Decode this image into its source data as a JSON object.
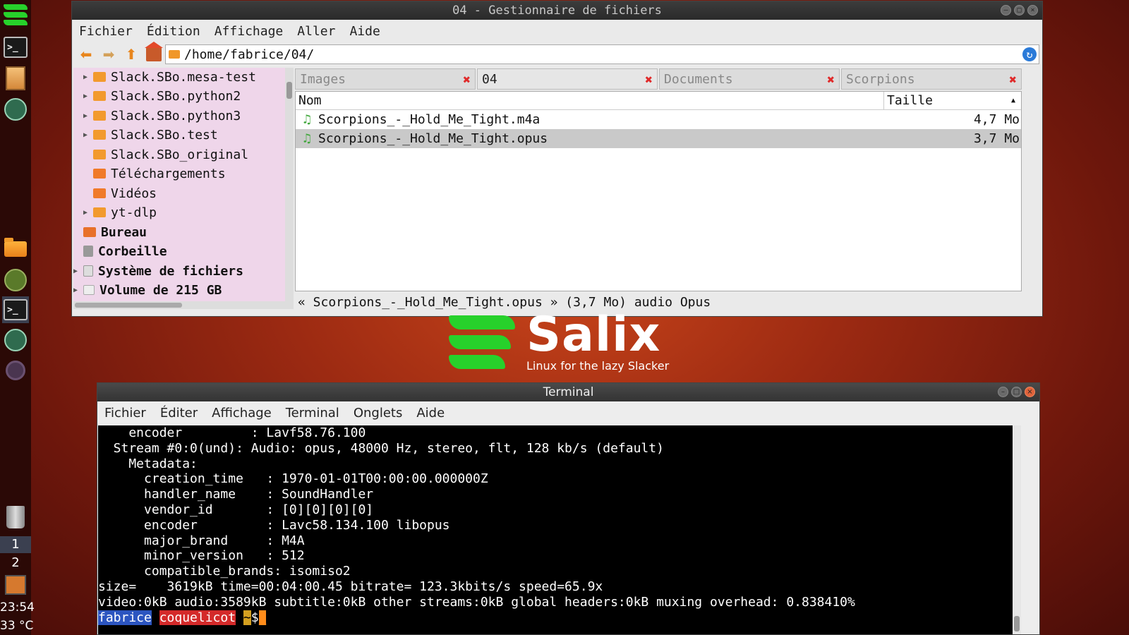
{
  "dock": {
    "workspaces": [
      "1",
      "2"
    ],
    "clock": "23:54",
    "temperature": "33 °C"
  },
  "file_manager": {
    "title": "04 - Gestionnaire de fichiers",
    "menu": [
      "Fichier",
      "Édition",
      "Affichage",
      "Aller",
      "Aide"
    ],
    "path": "/home/fabrice/04/",
    "tree": [
      {
        "label": "Slack.SBo.mesa-test",
        "expandable": true
      },
      {
        "label": "Slack.SBo.python2",
        "expandable": true
      },
      {
        "label": "Slack.SBo.python3",
        "expandable": true
      },
      {
        "label": "Slack.SBo.test",
        "expandable": true
      },
      {
        "label": "Slack.SBo_original",
        "expandable": false
      },
      {
        "label": "Téléchargements",
        "expandable": false
      },
      {
        "label": "Vidéos",
        "expandable": false
      },
      {
        "label": "yt-dlp",
        "expandable": true
      }
    ],
    "places": [
      {
        "label": "Bureau",
        "expandable": false
      },
      {
        "label": "Corbeille",
        "expandable": false
      },
      {
        "label": "Système de fichiers",
        "expandable": true
      },
      {
        "label": "Volume de 215 GB",
        "expandable": true
      }
    ],
    "tabs": [
      "Images",
      "04",
      "Documents",
      "Scorpions"
    ],
    "active_tab": "04",
    "columns": {
      "name": "Nom",
      "size": "Taille"
    },
    "files": [
      {
        "name": "Scorpions_-_Hold_Me_Tight.m4a",
        "size": "4,7 Mo",
        "selected": false
      },
      {
        "name": "Scorpions_-_Hold_Me_Tight.opus",
        "size": "3,7 Mo",
        "selected": true
      }
    ],
    "status": "« Scorpions_-_Hold_Me_Tight.opus » (3,7 Mo) audio Opus"
  },
  "logo": {
    "name": "Salix",
    "tagline": "Linux for the lazy Slacker"
  },
  "terminal": {
    "title": "Terminal",
    "menu": [
      "Fichier",
      "Éditer",
      "Affichage",
      "Terminal",
      "Onglets",
      "Aide"
    ],
    "lines": [
      "    encoder         : Lavf58.76.100",
      "  Stream #0:0(und): Audio: opus, 48000 Hz, stereo, flt, 128 kb/s (default)",
      "    Metadata:",
      "      creation_time   : 1970-01-01T00:00:00.000000Z",
      "      handler_name    : SoundHandler",
      "      vendor_id       : [0][0][0][0]",
      "      encoder         : Lavc58.134.100 libopus",
      "      major_brand     : M4A",
      "      minor_version   : 512",
      "      compatible_brands: isomiso2",
      "size=    3619kB time=00:04:00.45 bitrate= 123.3kbits/s speed=65.9x",
      "video:0kB audio:3589kB subtitle:0kB other streams:0kB global headers:0kB muxing overhead: 0.838410%"
    ],
    "prompt": {
      "user": "fabrice",
      "host": "coquelicot",
      "dir": "~",
      "symbol": "$"
    }
  }
}
